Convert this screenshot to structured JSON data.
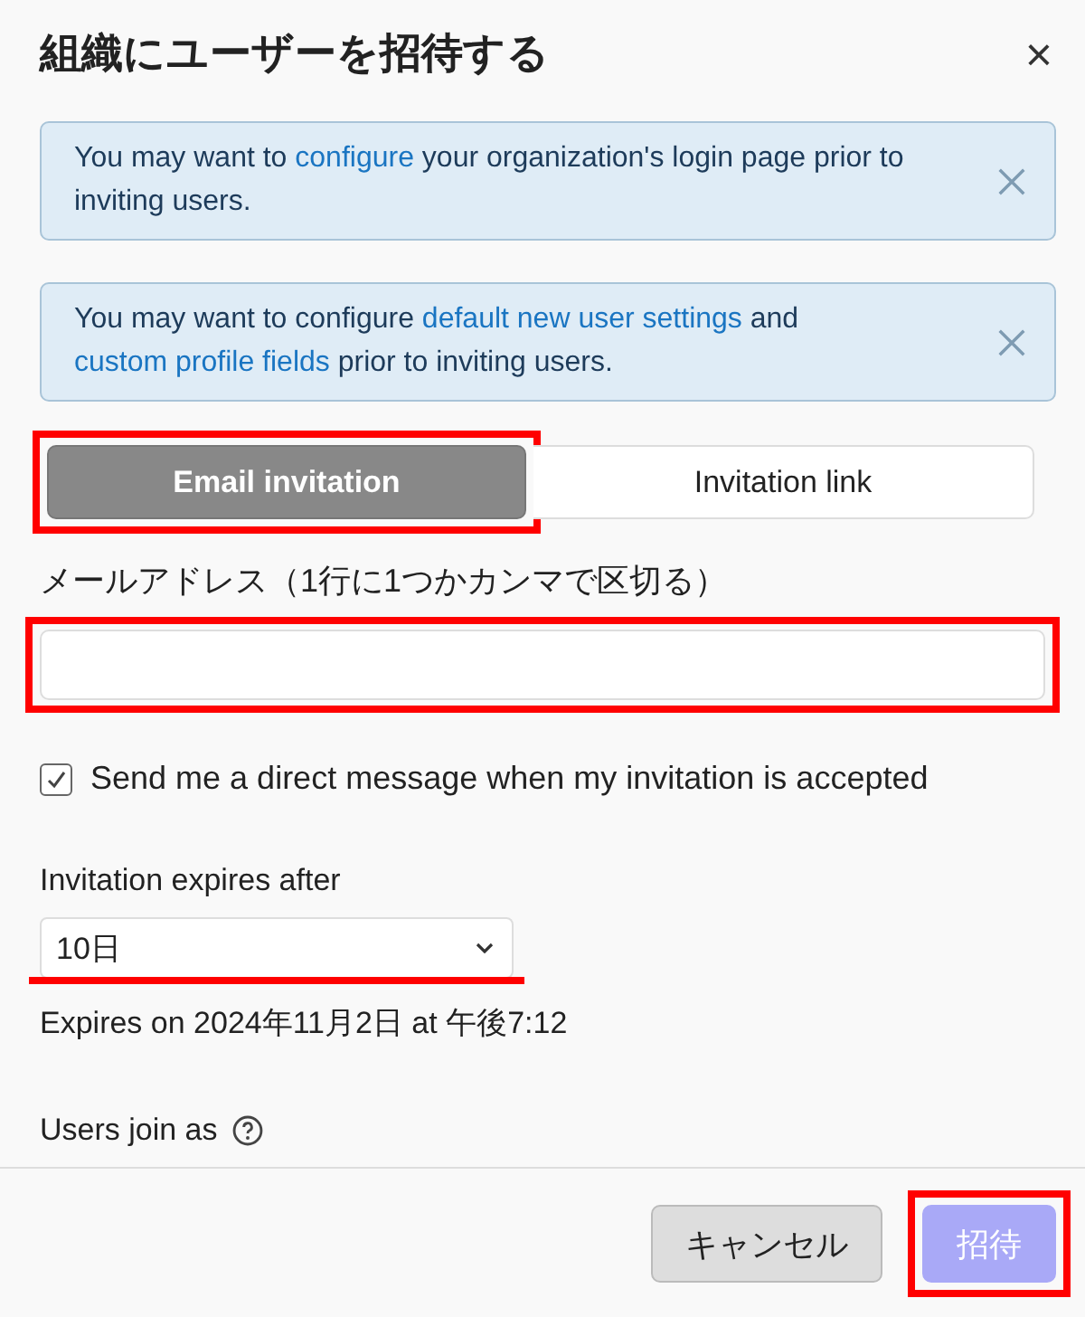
{
  "dialog": {
    "title": "組織にユーザーを招待する",
    "close": "×"
  },
  "banners": [
    {
      "segments": [
        {
          "text": "You may want to ",
          "kind": "text"
        },
        {
          "text": "configure",
          "kind": "link"
        },
        {
          "text": " your organization's login page prior to inviting users.",
          "kind": "text"
        }
      ]
    },
    {
      "segments": [
        {
          "text": "You may want to configure ",
          "kind": "text"
        },
        {
          "text": "default new user settings",
          "kind": "link"
        },
        {
          "text": " and ",
          "kind": "text"
        },
        {
          "text": "custom profile fields",
          "kind": "link"
        },
        {
          "text": " prior to inviting users.",
          "kind": "text"
        }
      ]
    }
  ],
  "tabs": [
    {
      "label": "Email invitation",
      "selected": true,
      "highlighted": true
    },
    {
      "label": "Invitation link",
      "selected": false,
      "highlighted": false
    }
  ],
  "email_field": {
    "label": "メールアドレス（1行に1つかカンマで区切る）",
    "highlighted": true
  },
  "notify_checkbox": {
    "label": "Send me a direct message when my invitation is accepted",
    "checked": true
  },
  "expiry": {
    "label": "Invitation expires after",
    "value": "10日",
    "highlighted": true,
    "note": "Expires on 2024年11月2日 at 午後7:12"
  },
  "join_as": {
    "label": "Users join as"
  },
  "buttons": [
    {
      "label": "キャンセル",
      "kind": "secondary",
      "disabled": false,
      "highlighted": false
    },
    {
      "label": "招待",
      "kind": "primary",
      "disabled": true,
      "highlighted": true
    }
  ]
}
